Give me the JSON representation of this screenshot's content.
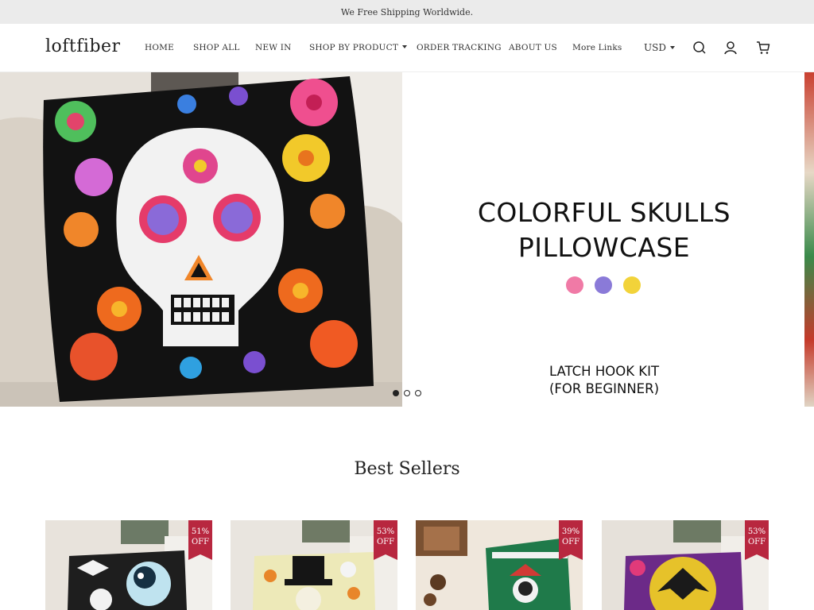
{
  "announcement": "We Free Shipping Worldwide.",
  "logo": "loftfiber",
  "nav": {
    "home": "HOME",
    "shop_all": "SHOP ALL",
    "new_in": "NEW IN",
    "shop_by_product": "SHOP BY PRODUCT",
    "order_tracking": "ORDER TRACKING",
    "about_us": "ABOUT US",
    "more_links": "More Links"
  },
  "currency": "USD",
  "icons": {
    "search": "search-icon",
    "account": "user-icon",
    "cart": "cart-icon"
  },
  "hero": {
    "title_line1": "COLORFUL SKULLS",
    "title_line2": "PILLOWCASE",
    "color_swatches": [
      "#f07aa6",
      "#8a7ad8",
      "#f2d33a"
    ],
    "subtitle_line1": "LATCH HOOK KIT",
    "subtitle_line2": "(FOR BEGINNER)",
    "slide_count": 3,
    "active_slide": 1
  },
  "best_sellers": {
    "title": "Best Sellers",
    "products": [
      {
        "badge_pct": "51%",
        "badge_off": "OFF"
      },
      {
        "badge_pct": "53%",
        "badge_off": "OFF"
      },
      {
        "badge_pct": "39%",
        "badge_off": "OFF"
      },
      {
        "badge_pct": "53%",
        "badge_off": "OFF"
      }
    ]
  },
  "colors": {
    "badge": "#b8273f",
    "announcement_bg": "#ebebeb"
  }
}
